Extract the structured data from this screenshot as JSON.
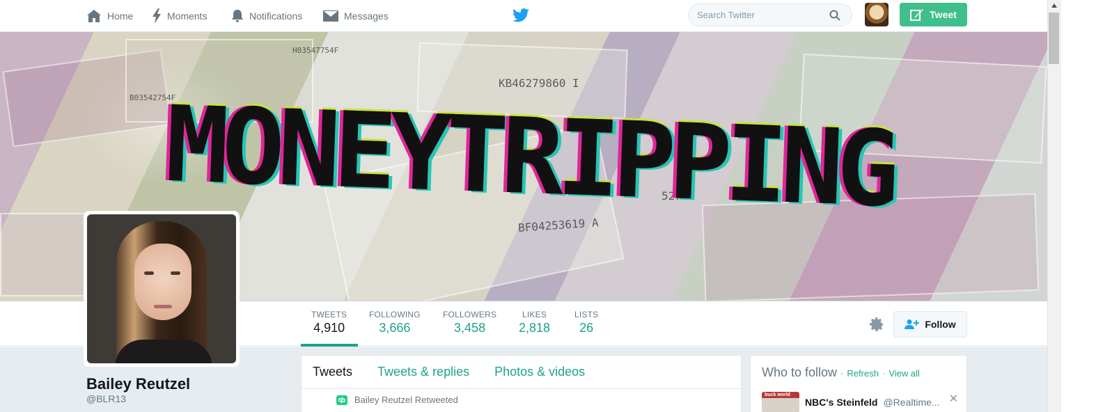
{
  "nav": {
    "home": "Home",
    "moments": "Moments",
    "notifications": "Notifications",
    "messages": "Messages",
    "search_placeholder": "Search Twitter",
    "tweet_button": "Tweet"
  },
  "banner": {
    "text": "MONEYTRIPPING",
    "serials": [
      "KB46279860 I",
      "B03542754F",
      "BF04253619 A",
      "H03547754F",
      "52798"
    ]
  },
  "profile": {
    "name": "Bailey Reutzel",
    "handle": "@BLR13"
  },
  "stats": [
    {
      "label": "TWEETS",
      "value": "4,910"
    },
    {
      "label": "FOLLOWING",
      "value": "3,666"
    },
    {
      "label": "FOLLOWERS",
      "value": "3,458"
    },
    {
      "label": "LIKES",
      "value": "2,818"
    },
    {
      "label": "LISTS",
      "value": "26"
    }
  ],
  "follow_button": "Follow",
  "tabs": [
    "Tweets",
    "Tweets & replies",
    "Photos & videos"
  ],
  "retweet_line": "Bailey Reutzel Retweeted",
  "who_to_follow": {
    "title": "Who to follow",
    "refresh": "Refresh",
    "view_all": "View all",
    "separator": "·",
    "suggestion": {
      "name": "NBC's Steinfeld",
      "handle": "@Realtime...",
      "thumb_text": "buck world"
    }
  },
  "colors": {
    "accent": "#1da38a",
    "tweet_button": "#3fbf8b",
    "twitter_blue": "#1da1f2"
  }
}
